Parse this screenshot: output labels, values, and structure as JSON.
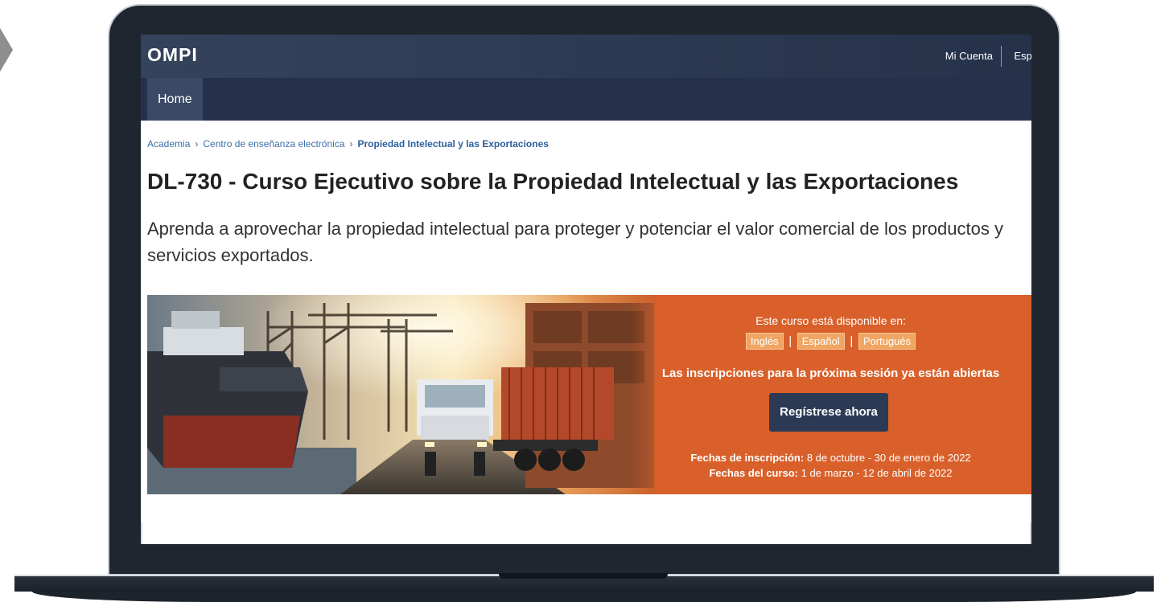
{
  "header": {
    "brand": "OMPI",
    "account_link": "Mi Cuenta",
    "language_link": "Espa"
  },
  "nav": {
    "home": "Home"
  },
  "breadcrumb": {
    "items": [
      "Academia",
      "Centro de enseñanza electrónica"
    ],
    "current": "Propiedad Intelectual y las Exportaciones",
    "separator": "›"
  },
  "page": {
    "title": "DL-730 - Curso Ejecutivo sobre la Propiedad Intelectual y las Exportaciones",
    "lead": "Aprenda a aprovechar la propiedad intelectual para proteger y potenciar el valor comercial de los productos y servicios exportados."
  },
  "banner": {
    "available_text": "Este curso está disponible en:",
    "languages": [
      "Inglés",
      "Español",
      "Portugués"
    ],
    "language_separator": "|",
    "open_text": "Las inscripciones para la próxima sesión ya están abiertas",
    "cta": "Regístrese ahora",
    "registration_label": "Fechas de inscripción:",
    "registration_dates": "8 de octubre - 30 de enero de 2022",
    "course_label": "Fechas del curso:",
    "course_dates": "1 de marzo - 12 de abril de 2022",
    "colors": {
      "banner_orange": "#d9602a",
      "button_navy": "#2c3a55",
      "tag_orange": "#f0a562"
    }
  },
  "colors": {
    "topbar": "#2e3c55",
    "navbar": "#25314a",
    "link": "#3f6ea7"
  }
}
